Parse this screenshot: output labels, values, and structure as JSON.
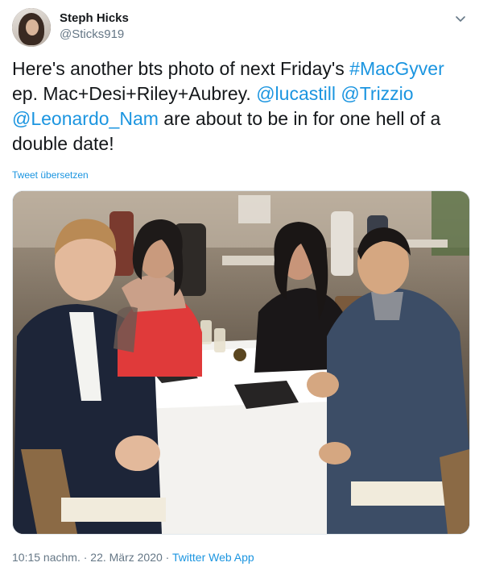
{
  "author": {
    "name": "Steph Hicks",
    "handle": "@Sticks919"
  },
  "tweet": {
    "line1_text": "Here's another bts photo of next Friday's ",
    "hashtag": "#MacGyver",
    "line2_text": " ep. Mac+Desi+Riley+Aubrey. ",
    "mention1": "@lucastill",
    "space1": " ",
    "mention2": "@Trizzio",
    "space2": " ",
    "mention3": "@Leonardo_Nam",
    "line3_text": " are about to be in for one hell of a double date!"
  },
  "translate_label": "Tweet übersetzen",
  "meta": {
    "time": "10:15 nachm.",
    "separator": " · ",
    "date": "22. März 2020",
    "source": "Twitter Web App"
  },
  "icons": {
    "menu": "chevron-down-icon"
  },
  "colors": {
    "link": "#1b95e0",
    "text": "#14171a",
    "secondary": "#657786"
  }
}
